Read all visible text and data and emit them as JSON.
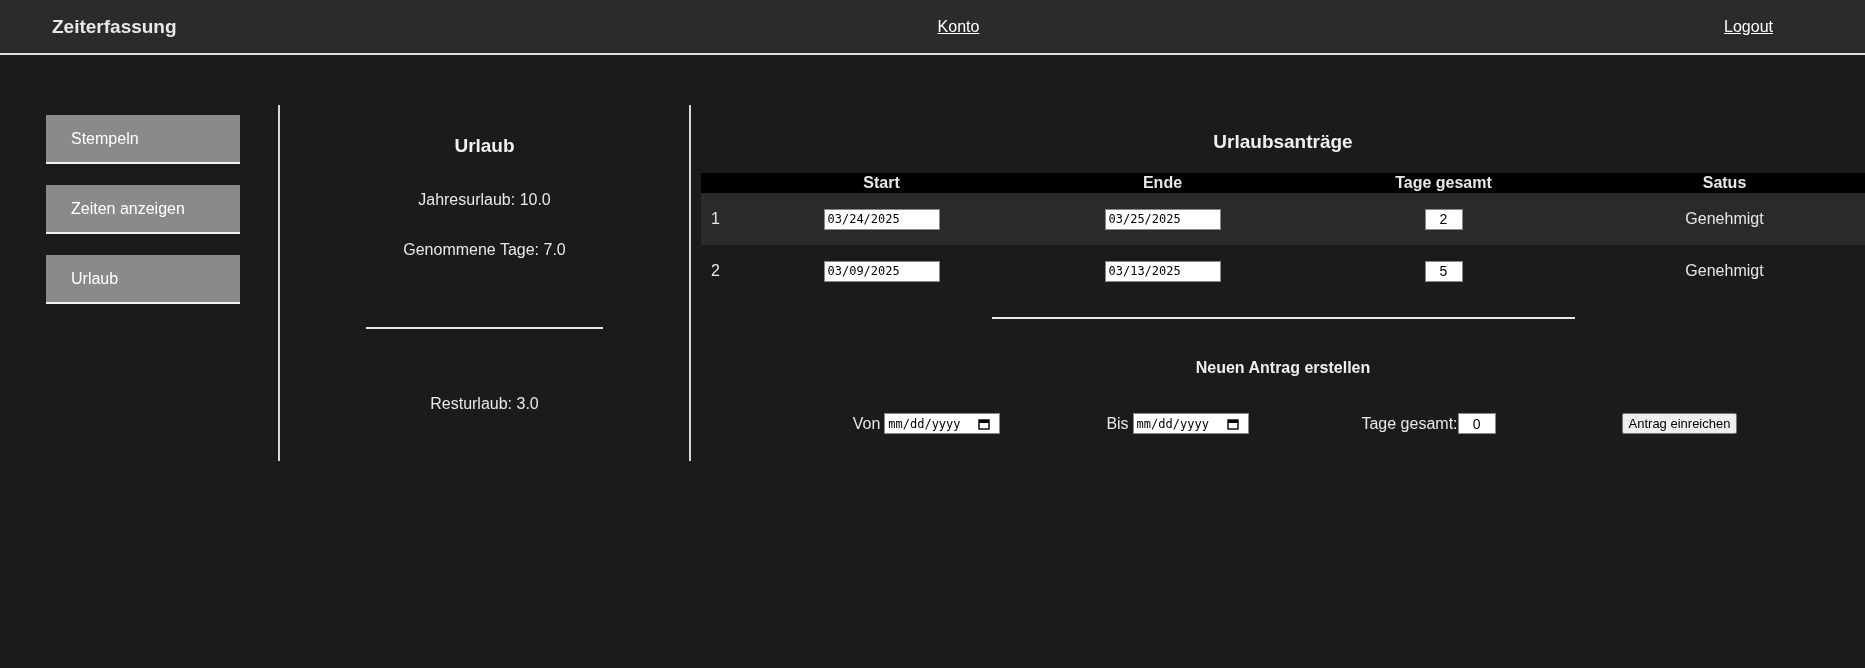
{
  "header": {
    "title": "Zeiterfassung",
    "links": [
      "Konto",
      "Logout"
    ]
  },
  "sidebar": {
    "items": [
      {
        "label": "Stempeln"
      },
      {
        "label": "Zeiten anzeigen"
      },
      {
        "label": "Urlaub"
      }
    ]
  },
  "summary": {
    "title": "Urlaub",
    "lines": [
      "Jahresurlaub: 10.0",
      "Genommene Tage: 7.0"
    ],
    "rest": "Resturlaub: 3.0"
  },
  "requests": {
    "title": "Urlaubsanträge",
    "columns": [
      "Start",
      "Ende",
      "Tage gesamt",
      "Satus"
    ],
    "rows": [
      {
        "index": "1",
        "start": "03/24/2025",
        "end": "03/25/2025",
        "days": "2",
        "status": "Genehmigt"
      },
      {
        "index": "2",
        "start": "03/09/2025",
        "end": "03/13/2025",
        "days": "5",
        "status": "Genehmigt"
      }
    ]
  },
  "new_request": {
    "title": "Neuen Antrag erstellen",
    "from_label": "Von",
    "from_placeholder": "mm/dd/yyyy",
    "to_label": "Bis",
    "to_placeholder": "mm/dd/yyyy",
    "days_label": "Tage gesamt:",
    "days_value": "0",
    "submit": "Antrag einreichen"
  }
}
